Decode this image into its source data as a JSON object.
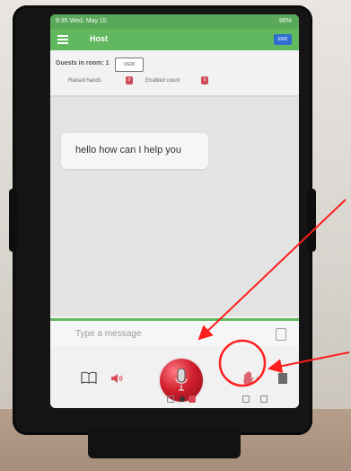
{
  "status_bar": {
    "time_date": "9:35 Wed, May 15",
    "battery": "86%"
  },
  "app_bar": {
    "title": "Host",
    "end_label": "END"
  },
  "guests": {
    "label": "Guests in room: 1",
    "view_label": "VIEW"
  },
  "counts": {
    "raised_hands_label": "Raised hands",
    "raised_hands_value": "0",
    "enabled_count_label": "Enabled count",
    "enabled_count_value": "0"
  },
  "chat": {
    "message_text": "hello how can I help you"
  },
  "input": {
    "placeholder": "Type a message"
  },
  "colors": {
    "green": "#61b85e",
    "end_blue": "#2f6fd1",
    "mic_red": "#d11f2d",
    "annotation_red": "#ff1e1e"
  },
  "icons": [
    "book-icon",
    "speaker-icon",
    "microphone-icon",
    "raise-hand-icon",
    "arrow-icon",
    "attach-icon",
    "menu-icon"
  ]
}
